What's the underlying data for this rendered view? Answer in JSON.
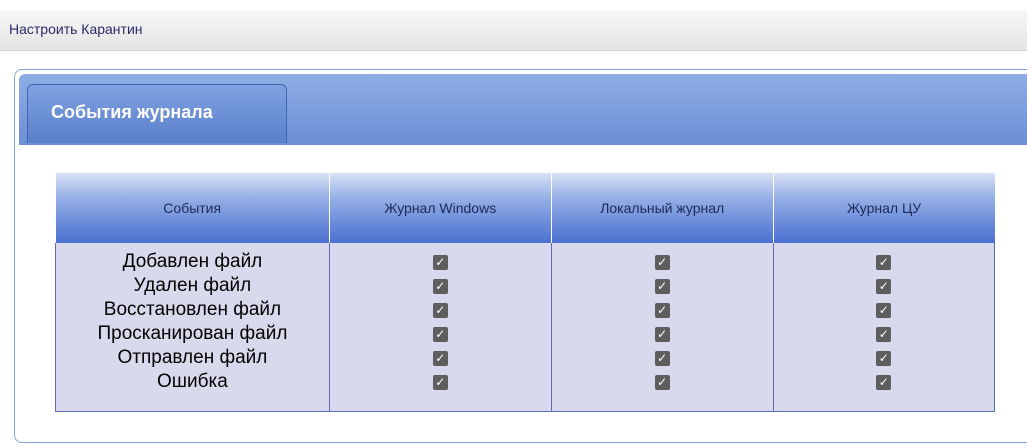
{
  "window": {
    "title": "Настроить Карантин"
  },
  "tab": {
    "label": "События журнала"
  },
  "table": {
    "headers": [
      "События",
      "Журнал Windows",
      "Локальный журнал",
      "Журнал ЦУ"
    ],
    "events": [
      "Добавлен файл",
      "Удален файл",
      "Восстановлен файл",
      "Просканирован файл",
      "Отправлен файл",
      "Ошибка"
    ],
    "check_mark": "✓",
    "windows_log": [
      true,
      true,
      true,
      true,
      true,
      true
    ],
    "local_log": [
      true,
      true,
      true,
      true,
      true,
      true
    ],
    "cu_log": [
      true,
      true,
      true,
      true,
      true,
      true
    ]
  },
  "colors": {
    "accent": "#6d8fd4",
    "header_dark": "#4a6fd0",
    "body_bg": "#d9d9ee",
    "checkbox": "#5e5e5e"
  }
}
